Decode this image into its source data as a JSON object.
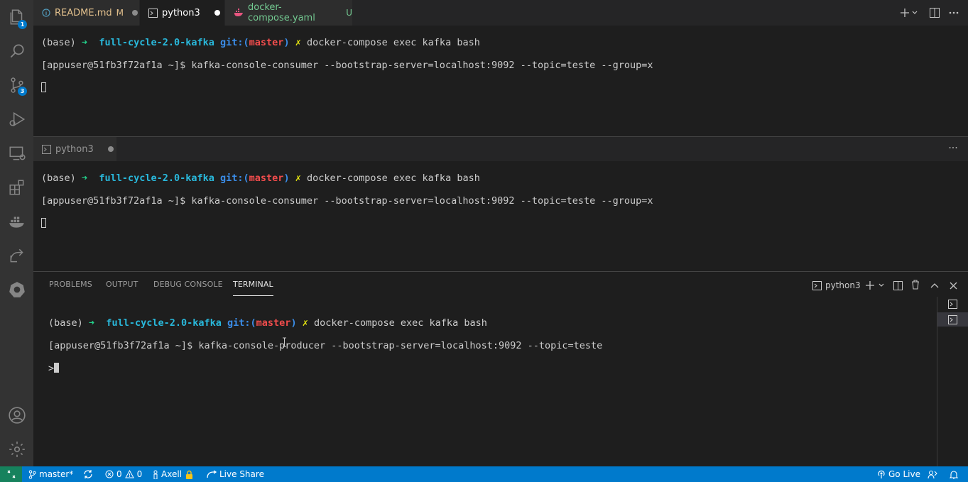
{
  "activity_bar": {
    "explorer_badge": "1",
    "scm_badge": "3"
  },
  "tabs": [
    {
      "label": "README.md",
      "mark": "M",
      "icon": "info-icon"
    },
    {
      "label": "python3",
      "icon": "terminal-icon"
    },
    {
      "label": "docker-compose.yaml",
      "mark": "U",
      "icon": "docker-icon"
    }
  ],
  "editor_terminal_1": {
    "line1": {
      "prefix": "(base) ",
      "arrow": "➜",
      "repo": "full-cycle-2.0-kafka",
      "git": "git:(",
      "branch": "master",
      "git_close": ")",
      "dirty": "✗",
      "command": "docker-compose exec kafka bash"
    },
    "line2": "[appuser@51fb3f72af1a ~]$ kafka-console-consumer --bootstrap-server=localhost:9092 --topic=teste --group=x"
  },
  "editor_group_2": {
    "tab_label": "python3",
    "more": "···"
  },
  "editor_terminal_2": {
    "line1": {
      "prefix": "(base) ",
      "arrow": "➜",
      "repo": "full-cycle-2.0-kafka",
      "git": "git:(",
      "branch": "master",
      "git_close": ")",
      "dirty": "✗",
      "command": "docker-compose exec kafka bash"
    },
    "line2": "[appuser@51fb3f72af1a ~]$ kafka-console-consumer --bootstrap-server=localhost:9092 --topic=teste --group=x"
  },
  "panel": {
    "tabs": [
      "PROBLEMS",
      "OUTPUT",
      "DEBUG CONSOLE",
      "TERMINAL"
    ],
    "active_tab": "TERMINAL",
    "terminal_name": "python3",
    "line1": {
      "prefix": "(base) ",
      "arrow": "➜",
      "repo": "full-cycle-2.0-kafka",
      "git": "git:(",
      "branch": "master",
      "git_close": ")",
      "dirty": "✗",
      "command": "docker-compose exec kafka bash"
    },
    "line2": "[appuser@51fb3f72af1a ~]$ kafka-console-producer --bootstrap-server=localhost:9092 --topic=teste",
    "prompt": ">"
  },
  "status_bar": {
    "branch": "master*",
    "errors": "0",
    "warnings": "0",
    "user": "Axell",
    "live_share": "Live Share",
    "go_live": "Go Live"
  },
  "colors": {
    "status_bar": "#007acc",
    "activity_bar": "#333333",
    "editor_bg": "#1e1e1e",
    "remote_indicator": "#16825d"
  }
}
